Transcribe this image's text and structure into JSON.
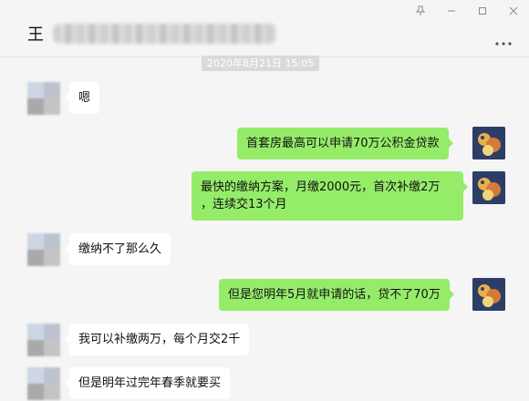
{
  "window": {
    "title": "王",
    "controls": [
      "pin-icon",
      "minimize-icon",
      "maximize-icon",
      "close-icon"
    ],
    "menu_icon": "more-icon"
  },
  "timestamp": "2020年8月21日 15:05",
  "colors": {
    "background": "#f5f5f5",
    "outgoing_bubble": "#95ec69",
    "incoming_bubble": "#ffffff",
    "timestamp_bg": "#dadada"
  },
  "messages": [
    {
      "from": "other",
      "text": "嗯"
    },
    {
      "from": "me",
      "text": "首套房最高可以申请70万公积金贷款"
    },
    {
      "from": "me",
      "lines": [
        "最快的缴纳方案，月缴2000元，首次补缴2万",
        "，连续交13个月"
      ]
    },
    {
      "from": "other",
      "text": "缴纳不了那么久"
    },
    {
      "from": "me",
      "text": "但是您明年5月就申请的话，贷不了70万"
    },
    {
      "from": "other",
      "text": "我可以补缴两万，每个月交2千"
    },
    {
      "from": "other",
      "text": "但是明年过完年春季就要买"
    }
  ]
}
